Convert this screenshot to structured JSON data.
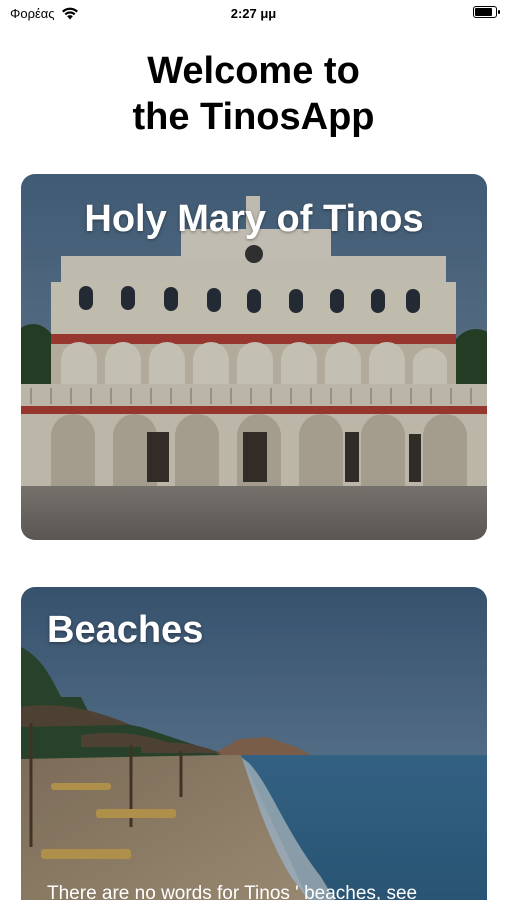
{
  "status_bar": {
    "carrier": "Φορέας",
    "time": "2:27 μμ",
    "battery_level": 0.85
  },
  "header": {
    "title_line1": "Welcome to",
    "title_line2": "the TinosApp"
  },
  "cards": [
    {
      "title": "Holy Mary of Tinos"
    },
    {
      "title": "Beaches",
      "description": "There are no words for Tinos ' beaches, see"
    }
  ]
}
